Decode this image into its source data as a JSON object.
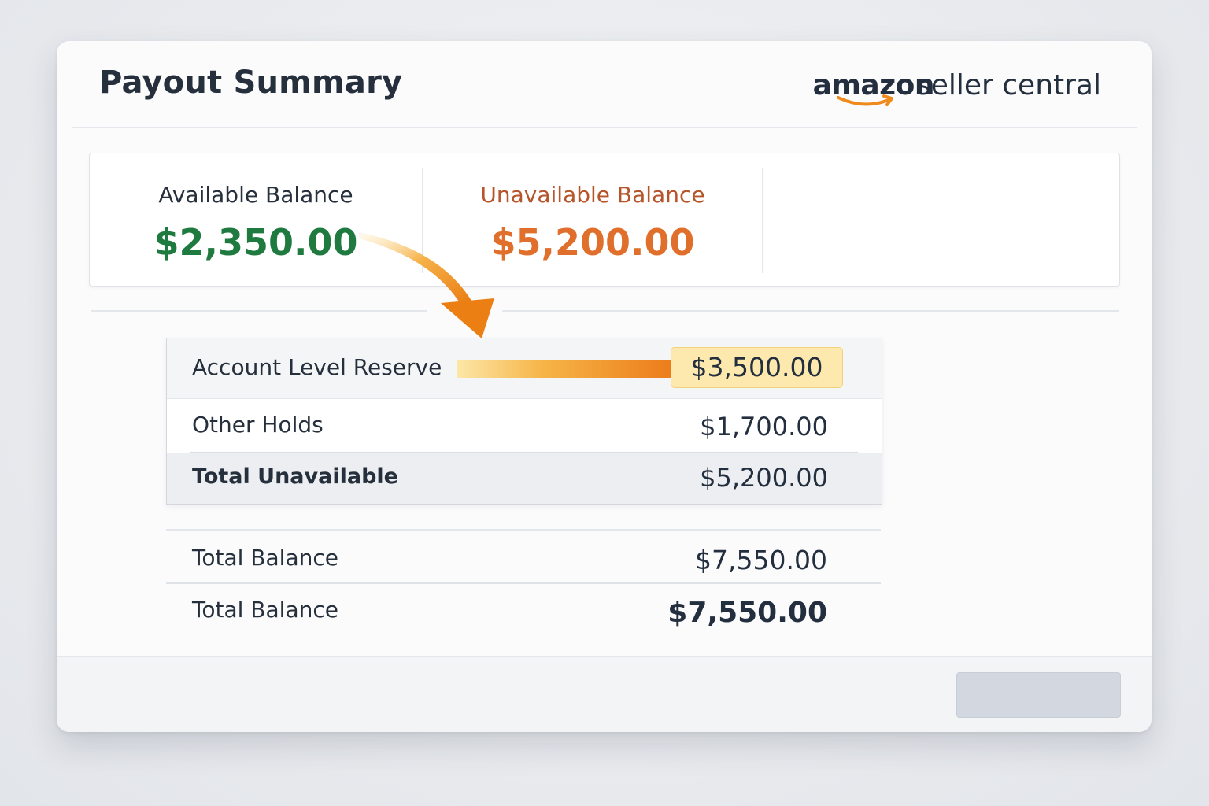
{
  "header": {
    "title": "Payout Summary",
    "logo": {
      "brand": "amazon",
      "product": "seller central"
    }
  },
  "balances": {
    "available": {
      "label": "Available Balance",
      "value": "$2,350.00",
      "color": "#1f7a3f"
    },
    "unavailable": {
      "label": "Unavailable Balance",
      "value": "$5,200.00",
      "color": "#e06f2c"
    }
  },
  "breakdown": {
    "rows": [
      {
        "label": "Account Level Reserve",
        "value": "$3,500.00",
        "highlighted": true
      },
      {
        "label": "Other Holds",
        "value": "$1,700.00"
      },
      {
        "label": "Total Unavailable",
        "value": "$5,200.00"
      }
    ]
  },
  "summary": {
    "rows": [
      {
        "label": "Total Balance",
        "value": "$7,550.00"
      },
      {
        "label": "Total Balance",
        "value": "$7,550.00"
      }
    ]
  },
  "footer": {
    "button_label": ""
  },
  "icons": {
    "arrow": "curved-arrow-icon",
    "logo_smile": "amazon-smile-icon"
  },
  "colors": {
    "accent": "#ec7d1b",
    "highlight": "#fde9ad"
  }
}
